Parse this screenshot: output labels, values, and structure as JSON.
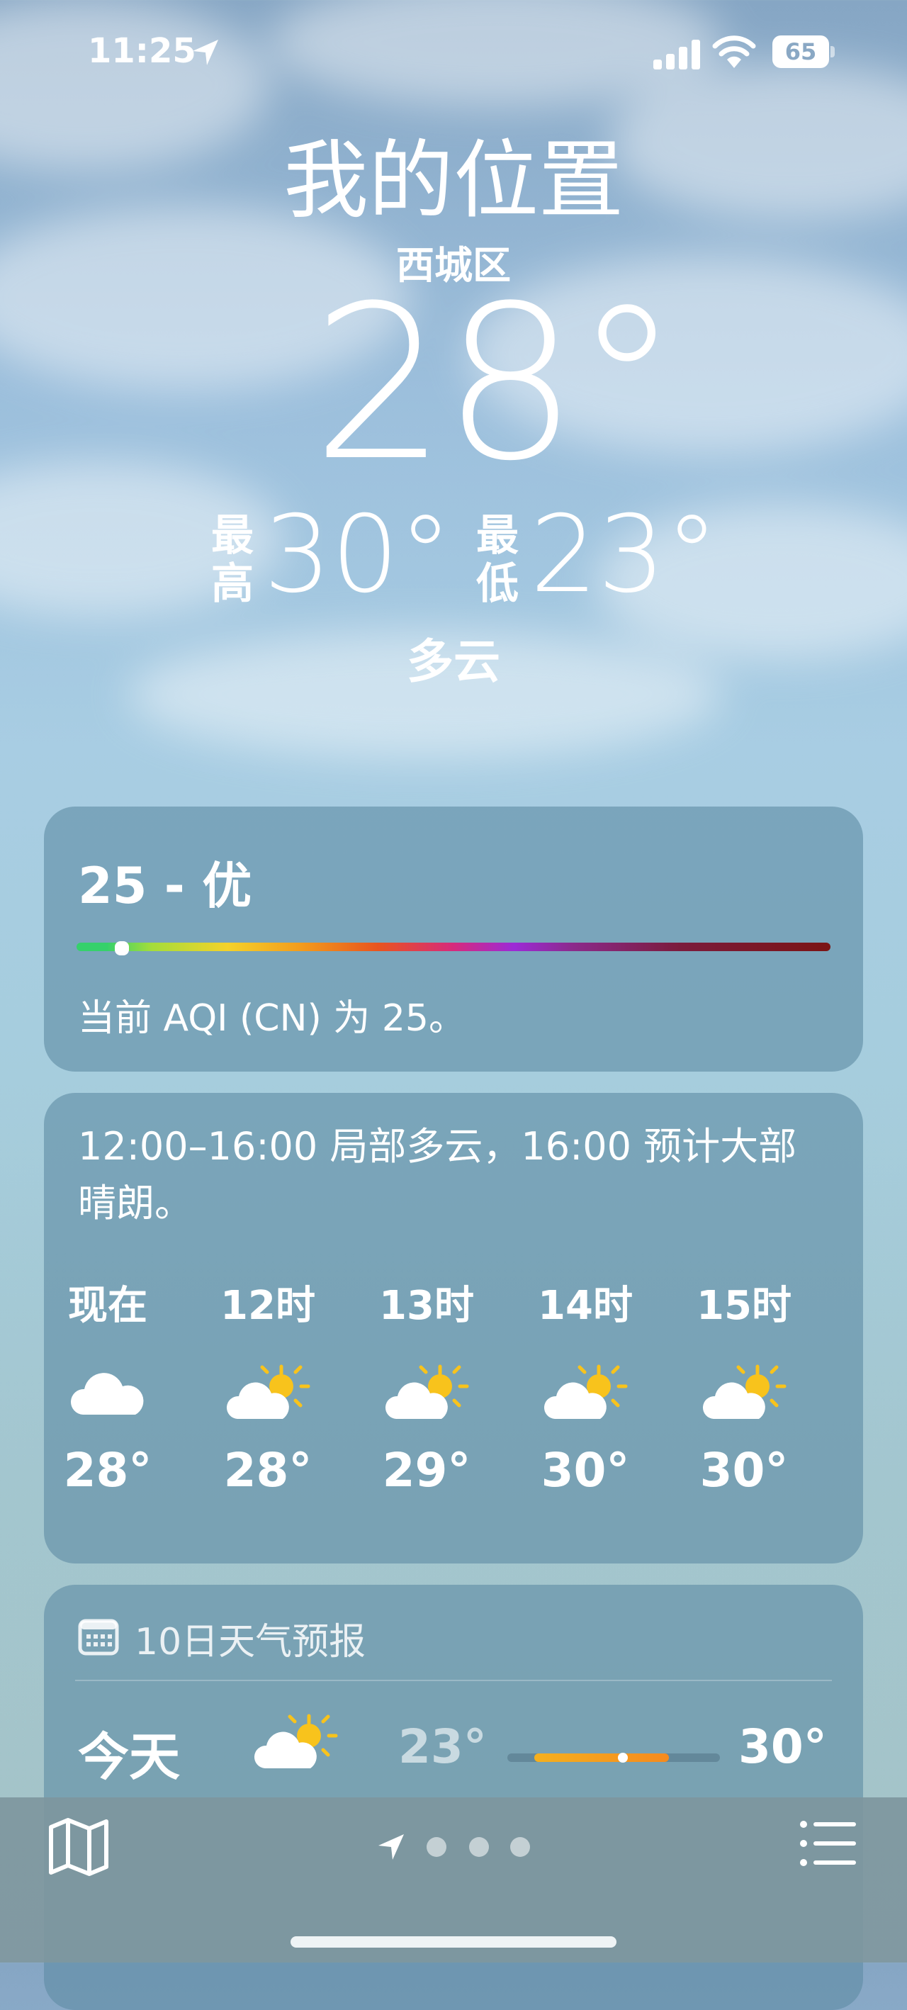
{
  "status_bar": {
    "time": "11:25",
    "battery": "65",
    "icons": [
      "location-arrow-icon",
      "cellular-signal-icon",
      "wifi-icon",
      "battery-icon"
    ]
  },
  "header": {
    "location": "我的位置",
    "district": "西城区",
    "temperature": "28°",
    "high_label": "最高",
    "high": "30°",
    "low_label": "最低",
    "low": "23°",
    "condition": "多云"
  },
  "aqi": {
    "value": "25 - 优",
    "description": "当前 AQI (CN) 为 25。",
    "level_fraction": 0.05
  },
  "hourly": {
    "summary": "12:00–16:00 局部多云，16:00 预计大部晴朗。",
    "hours": [
      {
        "label": "现在",
        "icon": "cloud-icon",
        "temp": "28°"
      },
      {
        "label": "12时",
        "icon": "partly-sunny-icon",
        "temp": "28°"
      },
      {
        "label": "13时",
        "icon": "partly-sunny-icon",
        "temp": "29°"
      },
      {
        "label": "14时",
        "icon": "partly-sunny-icon",
        "temp": "30°"
      },
      {
        "label": "15时",
        "icon": "partly-sunny-icon",
        "temp": "30°"
      }
    ]
  },
  "daily": {
    "title": "10日天气预报",
    "days": [
      {
        "name": "今天",
        "icon": "partly-sunny-icon",
        "low": "23°",
        "high": "30°"
      }
    ]
  },
  "bottom_bar": {
    "icons": [
      "map-icon",
      "location-arrow-icon",
      "page-dot",
      "page-dot",
      "page-dot",
      "list-icon"
    ]
  },
  "colors": {
    "sun": "#f8c31c",
    "aqi_good": "#35d16b",
    "temp_range": "#f5a01e"
  }
}
